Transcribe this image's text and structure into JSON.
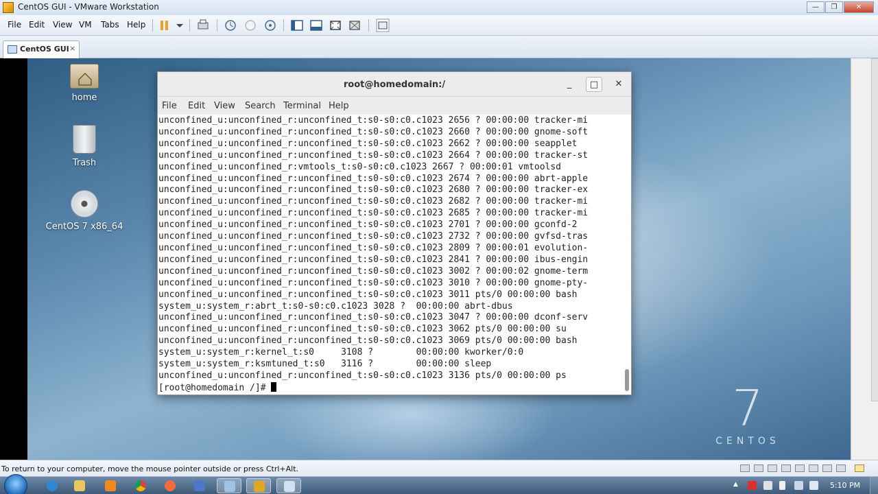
{
  "window": {
    "title": "CentOS GUI - VMware Workstation",
    "minimize": "—",
    "maximize": "❐",
    "close": "✕"
  },
  "menubar": {
    "items": [
      "File",
      "Edit",
      "View",
      "VM",
      "Tabs",
      "Help"
    ]
  },
  "tab": {
    "label": "CentOS GUI",
    "close": "×"
  },
  "desktop": {
    "icons": [
      {
        "label": "home",
        "icon": "home-folder-icon"
      },
      {
        "label": "Trash",
        "icon": "trash-icon"
      },
      {
        "label": "CentOS 7 x86_64",
        "icon": "disc-icon"
      }
    ],
    "logo": {
      "number": "7",
      "brand": "CENTOS"
    }
  },
  "terminal": {
    "title": "root@homedomain:/",
    "minimize": "_",
    "maximize": "□",
    "close": "✕",
    "menu": [
      "File",
      "Edit",
      "View",
      "Search",
      "Terminal",
      "Help"
    ],
    "lines": [
      "unconfined_u:unconfined_r:unconfined_t:s0-s0:c0.c1023 2656 ? 00:00:00 tracker-mi",
      "unconfined_u:unconfined_r:unconfined_t:s0-s0:c0.c1023 2660 ? 00:00:00 gnome-soft",
      "unconfined_u:unconfined_r:unconfined_t:s0-s0:c0.c1023 2662 ? 00:00:00 seapplet",
      "unconfined_u:unconfined_r:unconfined_t:s0-s0:c0.c1023 2664 ? 00:00:00 tracker-st",
      "unconfined_u:unconfined_r:vmtools_t:s0-s0:c0.c1023 2667 ? 00:00:01 vmtoolsd",
      "unconfined_u:unconfined_r:unconfined_t:s0-s0:c0.c1023 2674 ? 00:00:00 abrt-apple",
      "unconfined_u:unconfined_r:unconfined_t:s0-s0:c0.c1023 2680 ? 00:00:00 tracker-ex",
      "unconfined_u:unconfined_r:unconfined_t:s0-s0:c0.c1023 2682 ? 00:00:00 tracker-mi",
      "unconfined_u:unconfined_r:unconfined_t:s0-s0:c0.c1023 2685 ? 00:00:00 tracker-mi",
      "unconfined_u:unconfined_r:unconfined_t:s0-s0:c0.c1023 2701 ? 00:00:00 gconfd-2",
      "unconfined_u:unconfined_r:unconfined_t:s0-s0:c0.c1023 2732 ? 00:00:00 gvfsd-tras",
      "unconfined_u:unconfined_r:unconfined_t:s0-s0:c0.c1023 2809 ? 00:00:01 evolution-",
      "unconfined_u:unconfined_r:unconfined_t:s0-s0:c0.c1023 2841 ? 00:00:00 ibus-engin",
      "unconfined_u:unconfined_r:unconfined_t:s0-s0:c0.c1023 3002 ? 00:00:02 gnome-term",
      "unconfined_u:unconfined_r:unconfined_t:s0-s0:c0.c1023 3010 ? 00:00:00 gnome-pty-",
      "unconfined_u:unconfined_r:unconfined_t:s0-s0:c0.c1023 3011 pts/0 00:00:00 bash",
      "system_u:system_r:abrt_t:s0-s0:c0.c1023 3028 ?  00:00:00 abrt-dbus",
      "unconfined_u:unconfined_r:unconfined_t:s0-s0:c0.c1023 3047 ? 00:00:00 dconf-serv",
      "unconfined_u:unconfined_r:unconfined_t:s0-s0:c0.c1023 3062 pts/0 00:00:00 su",
      "unconfined_u:unconfined_r:unconfined_t:s0-s0:c0.c1023 3069 pts/0 00:00:00 bash",
      "system_u:system_r:kernel_t:s0     3108 ?        00:00:00 kworker/0:0",
      "system_u:system_r:ksmtuned_t:s0   3116 ?        00:00:00 sleep",
      "unconfined_u:unconfined_r:unconfined_t:s0-s0:c0.c1023 3136 pts/0 00:00:00 ps"
    ],
    "prompt": "[root@homedomain /]# "
  },
  "statusbar": {
    "message": "To return to your computer, move the mouse pointer outside or press Ctrl+Alt."
  },
  "taskbar": {
    "clock": "5:10 PM"
  },
  "colors": {
    "accent": "#1b63b6",
    "terminal_bg": "#ffffff",
    "terminal_text": "#222222"
  }
}
